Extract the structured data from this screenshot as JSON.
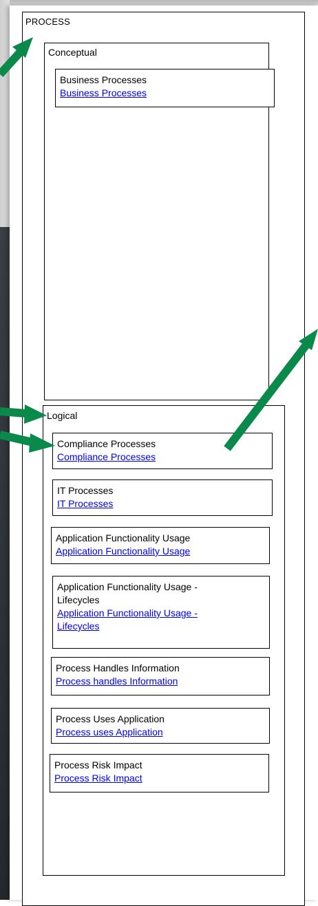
{
  "process": {
    "title": "PROCESS",
    "conceptual": {
      "title": "Conceptual",
      "items": [
        {
          "title": "Business Processes",
          "link": "Business Processes"
        }
      ]
    },
    "logical": {
      "title": "Logical",
      "items": [
        {
          "title": "Compliance Processes",
          "link": "Compliance Processes"
        },
        {
          "title": "IT Processes",
          "link": "IT Processes"
        },
        {
          "title": "Application Functionality Usage",
          "link": "Application Functionality Usage"
        },
        {
          "title": "Application Functionality Usage - Lifecycles",
          "link": "Application Functionality Usage - Lifecycles"
        },
        {
          "title": "Process Handles Information",
          "link": "Process handles Information"
        },
        {
          "title": "Process Uses Application",
          "link": "Process uses Application"
        },
        {
          "title": "Process Risk Impact",
          "link": "Process Risk Impact"
        }
      ]
    }
  },
  "colors": {
    "arrow": "#0a8a4a",
    "link": "#0000ee"
  }
}
